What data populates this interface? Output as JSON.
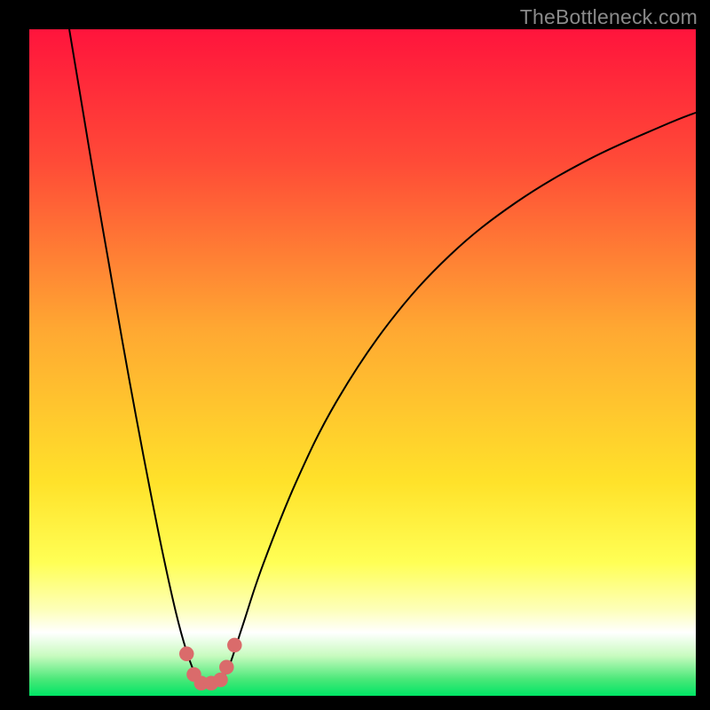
{
  "watermark": "TheBottleneck.com",
  "chart_data": {
    "type": "line",
    "title": "",
    "xlabel": "",
    "ylabel": "",
    "xlim": [
      0,
      100
    ],
    "ylim": [
      0,
      100
    ],
    "grid": false,
    "legend": false,
    "background_gradient": {
      "stops": [
        {
          "pos": 0.0,
          "color": "#ff143c"
        },
        {
          "pos": 0.2,
          "color": "#ff4b37"
        },
        {
          "pos": 0.45,
          "color": "#ffa832"
        },
        {
          "pos": 0.68,
          "color": "#ffe22a"
        },
        {
          "pos": 0.8,
          "color": "#ffff55"
        },
        {
          "pos": 0.87,
          "color": "#fdffb8"
        },
        {
          "pos": 0.905,
          "color": "#ffffff"
        },
        {
          "pos": 0.94,
          "color": "#c8fbbf"
        },
        {
          "pos": 0.975,
          "color": "#4be879"
        },
        {
          "pos": 1.0,
          "color": "#00e565"
        }
      ]
    },
    "series": [
      {
        "name": "left-branch",
        "stroke": "#000000",
        "points": [
          {
            "x": 6.0,
            "y": 100.0
          },
          {
            "x": 8.0,
            "y": 88.0
          },
          {
            "x": 10.0,
            "y": 76.0
          },
          {
            "x": 12.0,
            "y": 64.5
          },
          {
            "x": 14.0,
            "y": 53.0
          },
          {
            "x": 16.0,
            "y": 42.0
          },
          {
            "x": 18.0,
            "y": 31.5
          },
          {
            "x": 20.0,
            "y": 21.5
          },
          {
            "x": 22.0,
            "y": 12.5
          },
          {
            "x": 23.5,
            "y": 7.0
          },
          {
            "x": 25.0,
            "y": 3.0
          },
          {
            "x": 26.0,
            "y": 1.8
          }
        ]
      },
      {
        "name": "right-branch",
        "stroke": "#000000",
        "points": [
          {
            "x": 28.5,
            "y": 1.8
          },
          {
            "x": 30.0,
            "y": 4.5
          },
          {
            "x": 32.0,
            "y": 10.5
          },
          {
            "x": 35.0,
            "y": 19.5
          },
          {
            "x": 40.0,
            "y": 32.0
          },
          {
            "x": 46.0,
            "y": 44.0
          },
          {
            "x": 54.0,
            "y": 56.0
          },
          {
            "x": 63.0,
            "y": 66.0
          },
          {
            "x": 73.0,
            "y": 74.0
          },
          {
            "x": 84.0,
            "y": 80.5
          },
          {
            "x": 95.0,
            "y": 85.5
          },
          {
            "x": 100.0,
            "y": 87.5
          }
        ]
      }
    ],
    "markers": {
      "name": "bottom-cluster",
      "color": "#da6b6b",
      "radius_pct": 1.1,
      "points": [
        {
          "x": 23.6,
          "y": 6.3
        },
        {
          "x": 24.7,
          "y": 3.2
        },
        {
          "x": 25.8,
          "y": 1.9
        },
        {
          "x": 27.3,
          "y": 1.9
        },
        {
          "x": 28.7,
          "y": 2.4
        },
        {
          "x": 29.6,
          "y": 4.3
        },
        {
          "x": 30.8,
          "y": 7.6
        }
      ]
    }
  }
}
